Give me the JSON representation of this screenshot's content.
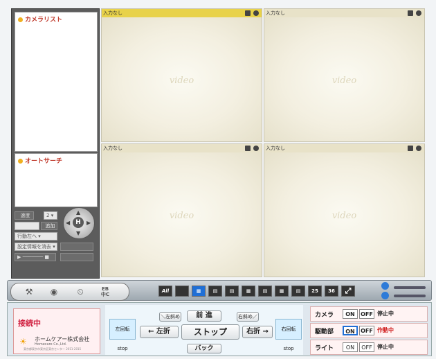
{
  "left_panel": {
    "camera_list_title": "カメラリスト",
    "auto_search_title": "オートサーチ",
    "controls": {
      "speed_label": "速度",
      "speed_value": "2",
      "add_button": "追加",
      "move_select": "行動左へ",
      "preset_select": "設定情報を消去"
    }
  },
  "video": {
    "cells": [
      {
        "label": "入力なし",
        "active": true,
        "watermark": "video"
      },
      {
        "label": "入力なし",
        "active": false,
        "watermark": "video"
      },
      {
        "label": "入力なし",
        "active": false,
        "watermark": "video"
      },
      {
        "label": "入力なし",
        "active": false,
        "watermark": "video"
      }
    ]
  },
  "toolbar": {
    "icons": [
      "tools-icon",
      "camera-icon",
      "schedule-icon",
      "language-icon"
    ],
    "lang_top": "EB",
    "lang_bottom": "中C",
    "layouts": [
      "All",
      "1",
      "4",
      "6",
      "8",
      "9",
      "13",
      "16",
      "25",
      "36",
      "fullscreen"
    ],
    "layout_25": "25",
    "layout_36": "36",
    "layout_all": "All",
    "selected_layout": "4"
  },
  "status": {
    "connection": "接続中",
    "company": "ホームケアー株式会社",
    "company_en": "Homecare Co.,Ltd.",
    "address": "東京都東京市東京区東京センター 2011-2015"
  },
  "ptz": {
    "left_rotate_stop": "左回転stop",
    "right_rotate_stop": "右回転stop",
    "up_left": "＼左斜め",
    "forward": "前 進",
    "up_right": "右斜め／",
    "left": "← 左折",
    "stop": "ストップ",
    "right": "右折 →",
    "back": "バック"
  },
  "devices": [
    {
      "label": "カメラ",
      "on": "ON",
      "off": "OFF",
      "state": "停止中",
      "state_color": "#222222"
    },
    {
      "label": "駆動部",
      "on": "ON",
      "off": "OFF",
      "state": "作動中",
      "state_color": "#d02020"
    },
    {
      "label": "ライト",
      "on": "ON",
      "off": "OFF",
      "state": "停止中",
      "state_color": "#222222"
    }
  ]
}
